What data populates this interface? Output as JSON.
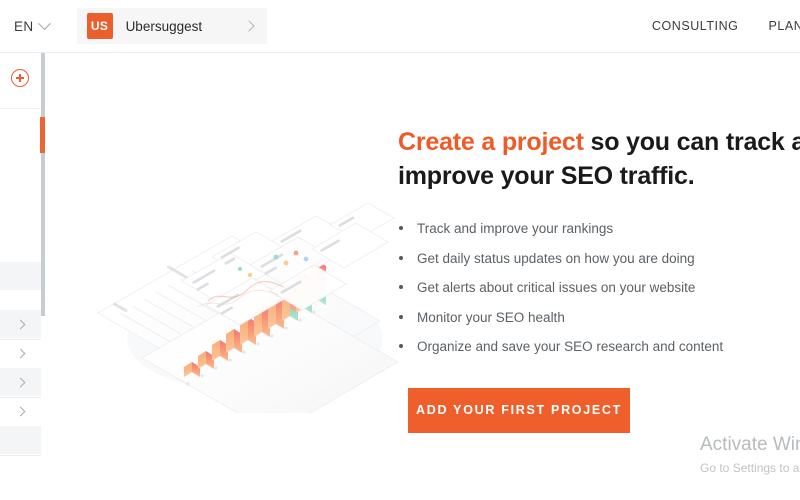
{
  "header": {
    "language": {
      "label": "EN",
      "icon": "chevron-down-icon"
    },
    "project": {
      "badge": "US",
      "name": "Ubersuggest",
      "icon": "chevron-right-icon"
    },
    "nav": [
      {
        "label": "CONSULTING"
      },
      {
        "label": "PLANS & P"
      }
    ]
  },
  "sidebar": {
    "add_icon": "plus-circle-icon",
    "scrollbar": {
      "thumb_color": "#ec6434",
      "track_color": "#c4cdd2"
    },
    "rows": [
      {
        "icon": "",
        "has_chevron": false
      },
      {
        "icon": "chevron-right-icon",
        "has_chevron": true
      },
      {
        "icon": "chevron-right-icon",
        "has_chevron": true
      },
      {
        "icon": "chevron-right-icon",
        "has_chevron": true
      },
      {
        "icon": "chevron-right-icon",
        "has_chevron": true
      }
    ]
  },
  "main": {
    "headline": {
      "accent": "Create a project",
      "rest": " so you can track an",
      "line2": "improve your SEO traffic."
    },
    "bullets": [
      "Track and improve your rankings",
      "Get daily status updates on how you are doing",
      "Get alerts about critical issues on your website",
      "Monitor your SEO health",
      "Organize and save your SEO research and content"
    ],
    "cta_label": "ADD YOUR FIRST PROJECT",
    "illustration": {
      "name": "isometric-dashboard-illustration",
      "description": "Faded isometric SEO dashboard with cards and an ascending bar chart"
    }
  },
  "watermark": {
    "title": "Activate Windo",
    "subtitle": "Go to Settings to a"
  },
  "colors": {
    "accent_orange": "#ee5f2b",
    "badge_orange": "#eb5f2c",
    "headline_dark": "#1a1a1a",
    "body_gray": "#5b6166",
    "pill_bg": "#f6f6f6",
    "band_gray": "#f4f5f6",
    "divider_gray": "#c4cdd2"
  }
}
